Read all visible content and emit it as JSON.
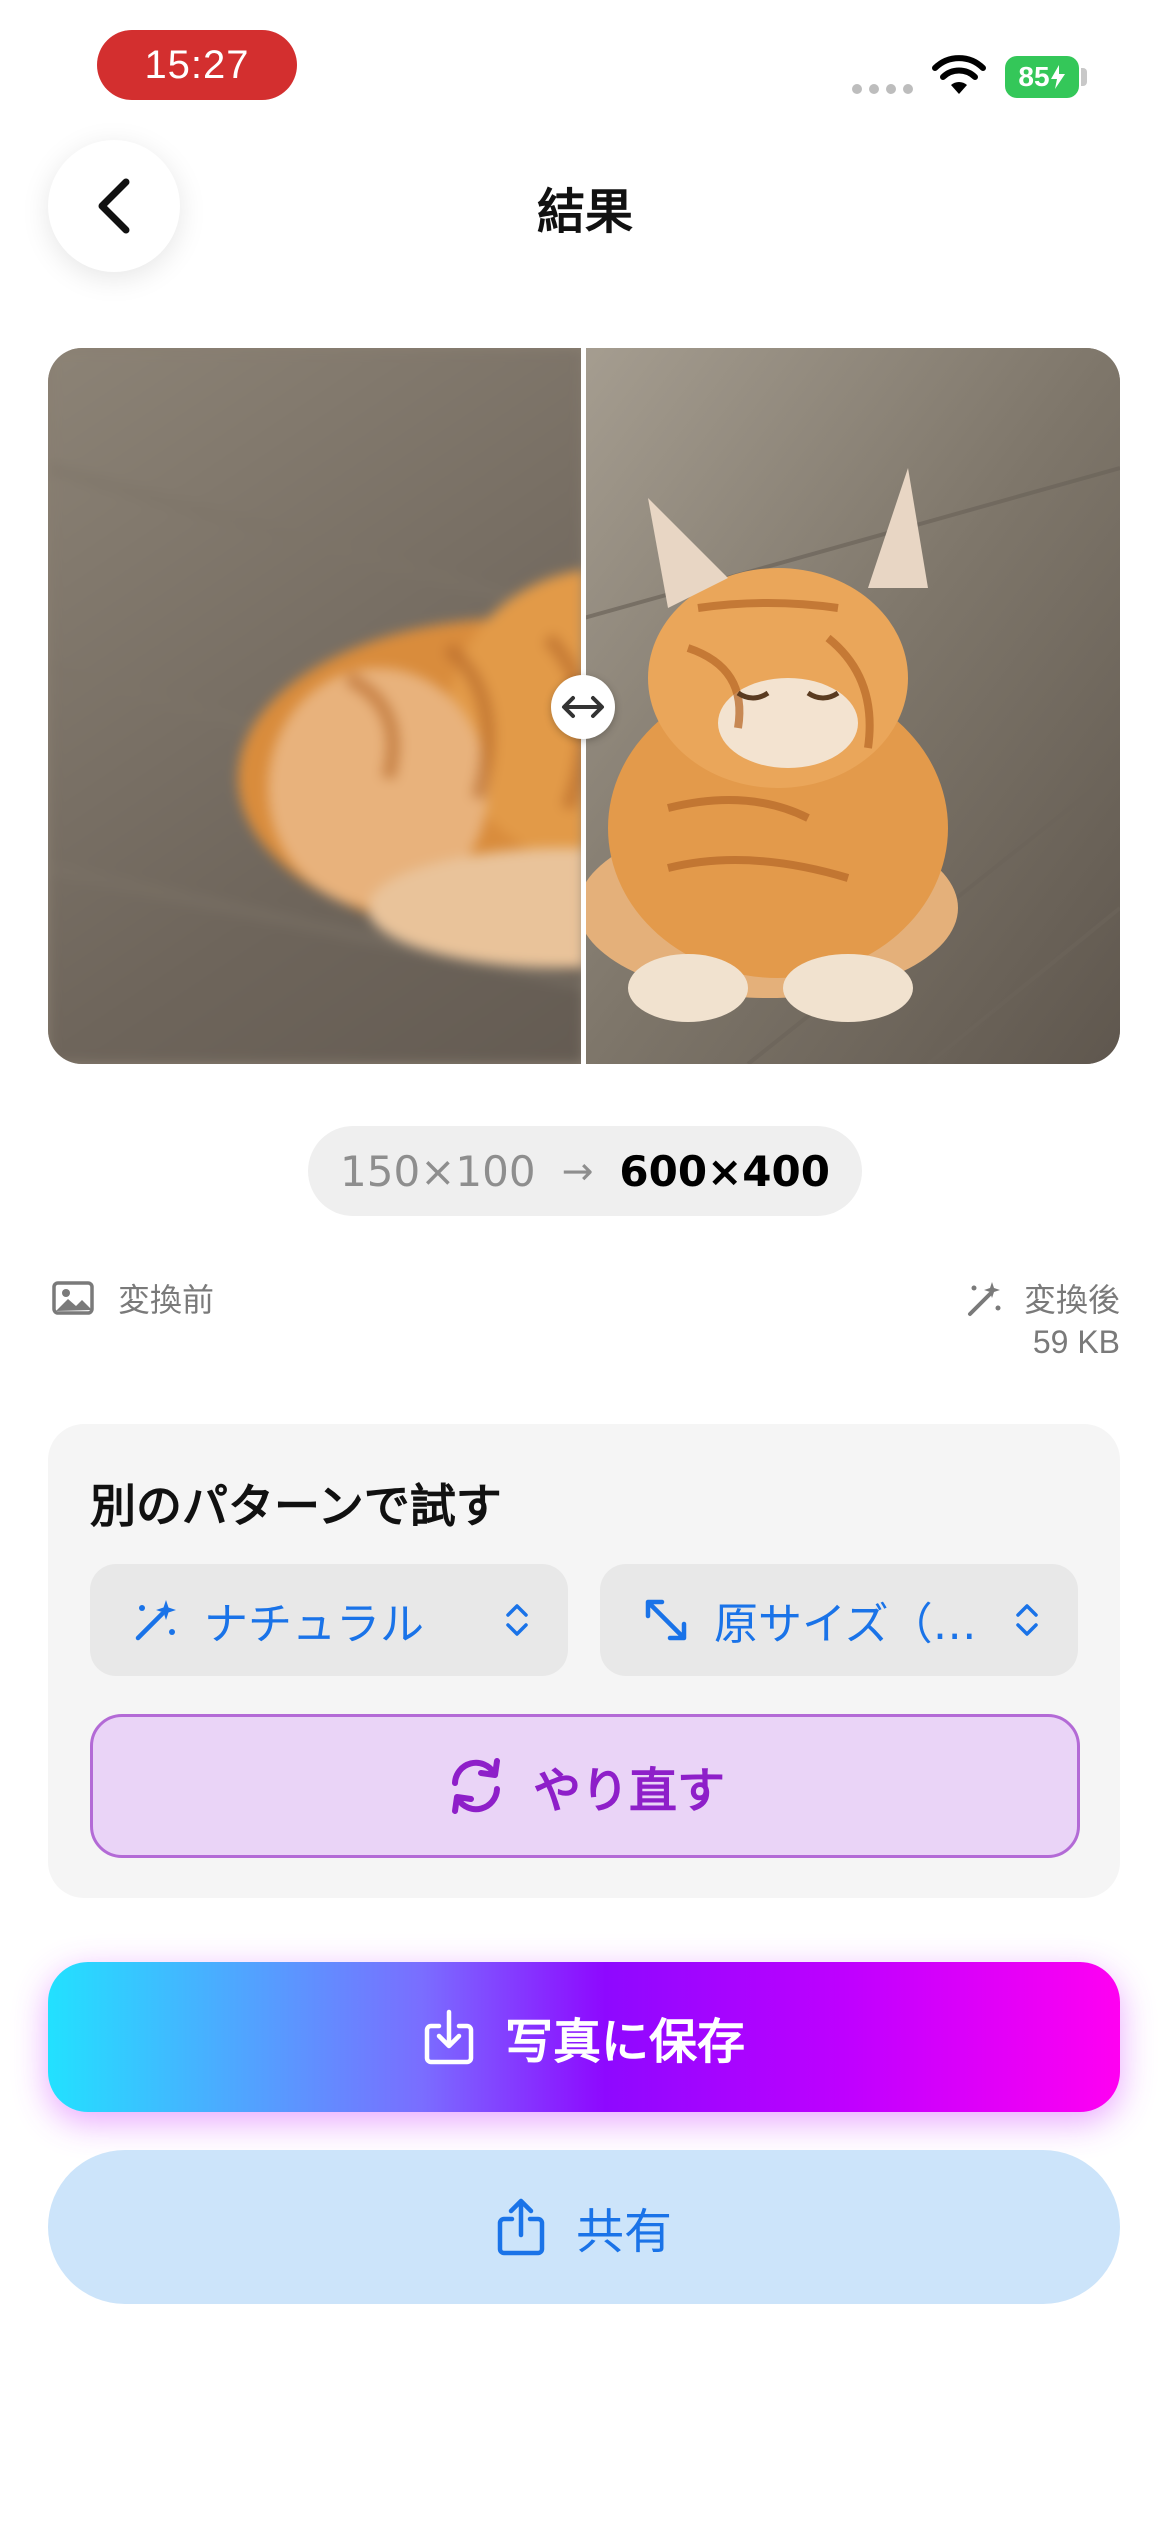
{
  "status_bar": {
    "time": "15:27",
    "battery": "85"
  },
  "header": {
    "title": "結果",
    "back_icon": "chevron-left-icon"
  },
  "comparison": {
    "handle_icon": "left-right-arrow-icon",
    "divider_position": 0.5
  },
  "resolution": {
    "from": "150×100",
    "arrow": "→",
    "to": "600×400"
  },
  "before": {
    "label": "変換前",
    "icon": "photo-icon"
  },
  "after": {
    "label": "変換後",
    "size": "59 KB",
    "icon": "magic-wand-icon"
  },
  "retry_card": {
    "title": "別のパターンで試す",
    "style_select": {
      "value": "ナチュラル",
      "icon": "magic-wand-icon"
    },
    "size_select": {
      "value": "原サイズ（…",
      "icon": "expand-arrows-icon"
    },
    "redo_label": "やり直す"
  },
  "actions": {
    "save_label": "写真に保存",
    "share_label": "共有"
  },
  "colors": {
    "accent_blue": "#1a73e8",
    "redo_purple": "#8e1fc9",
    "battery_green": "#34c759",
    "time_red": "#d32f2f"
  }
}
